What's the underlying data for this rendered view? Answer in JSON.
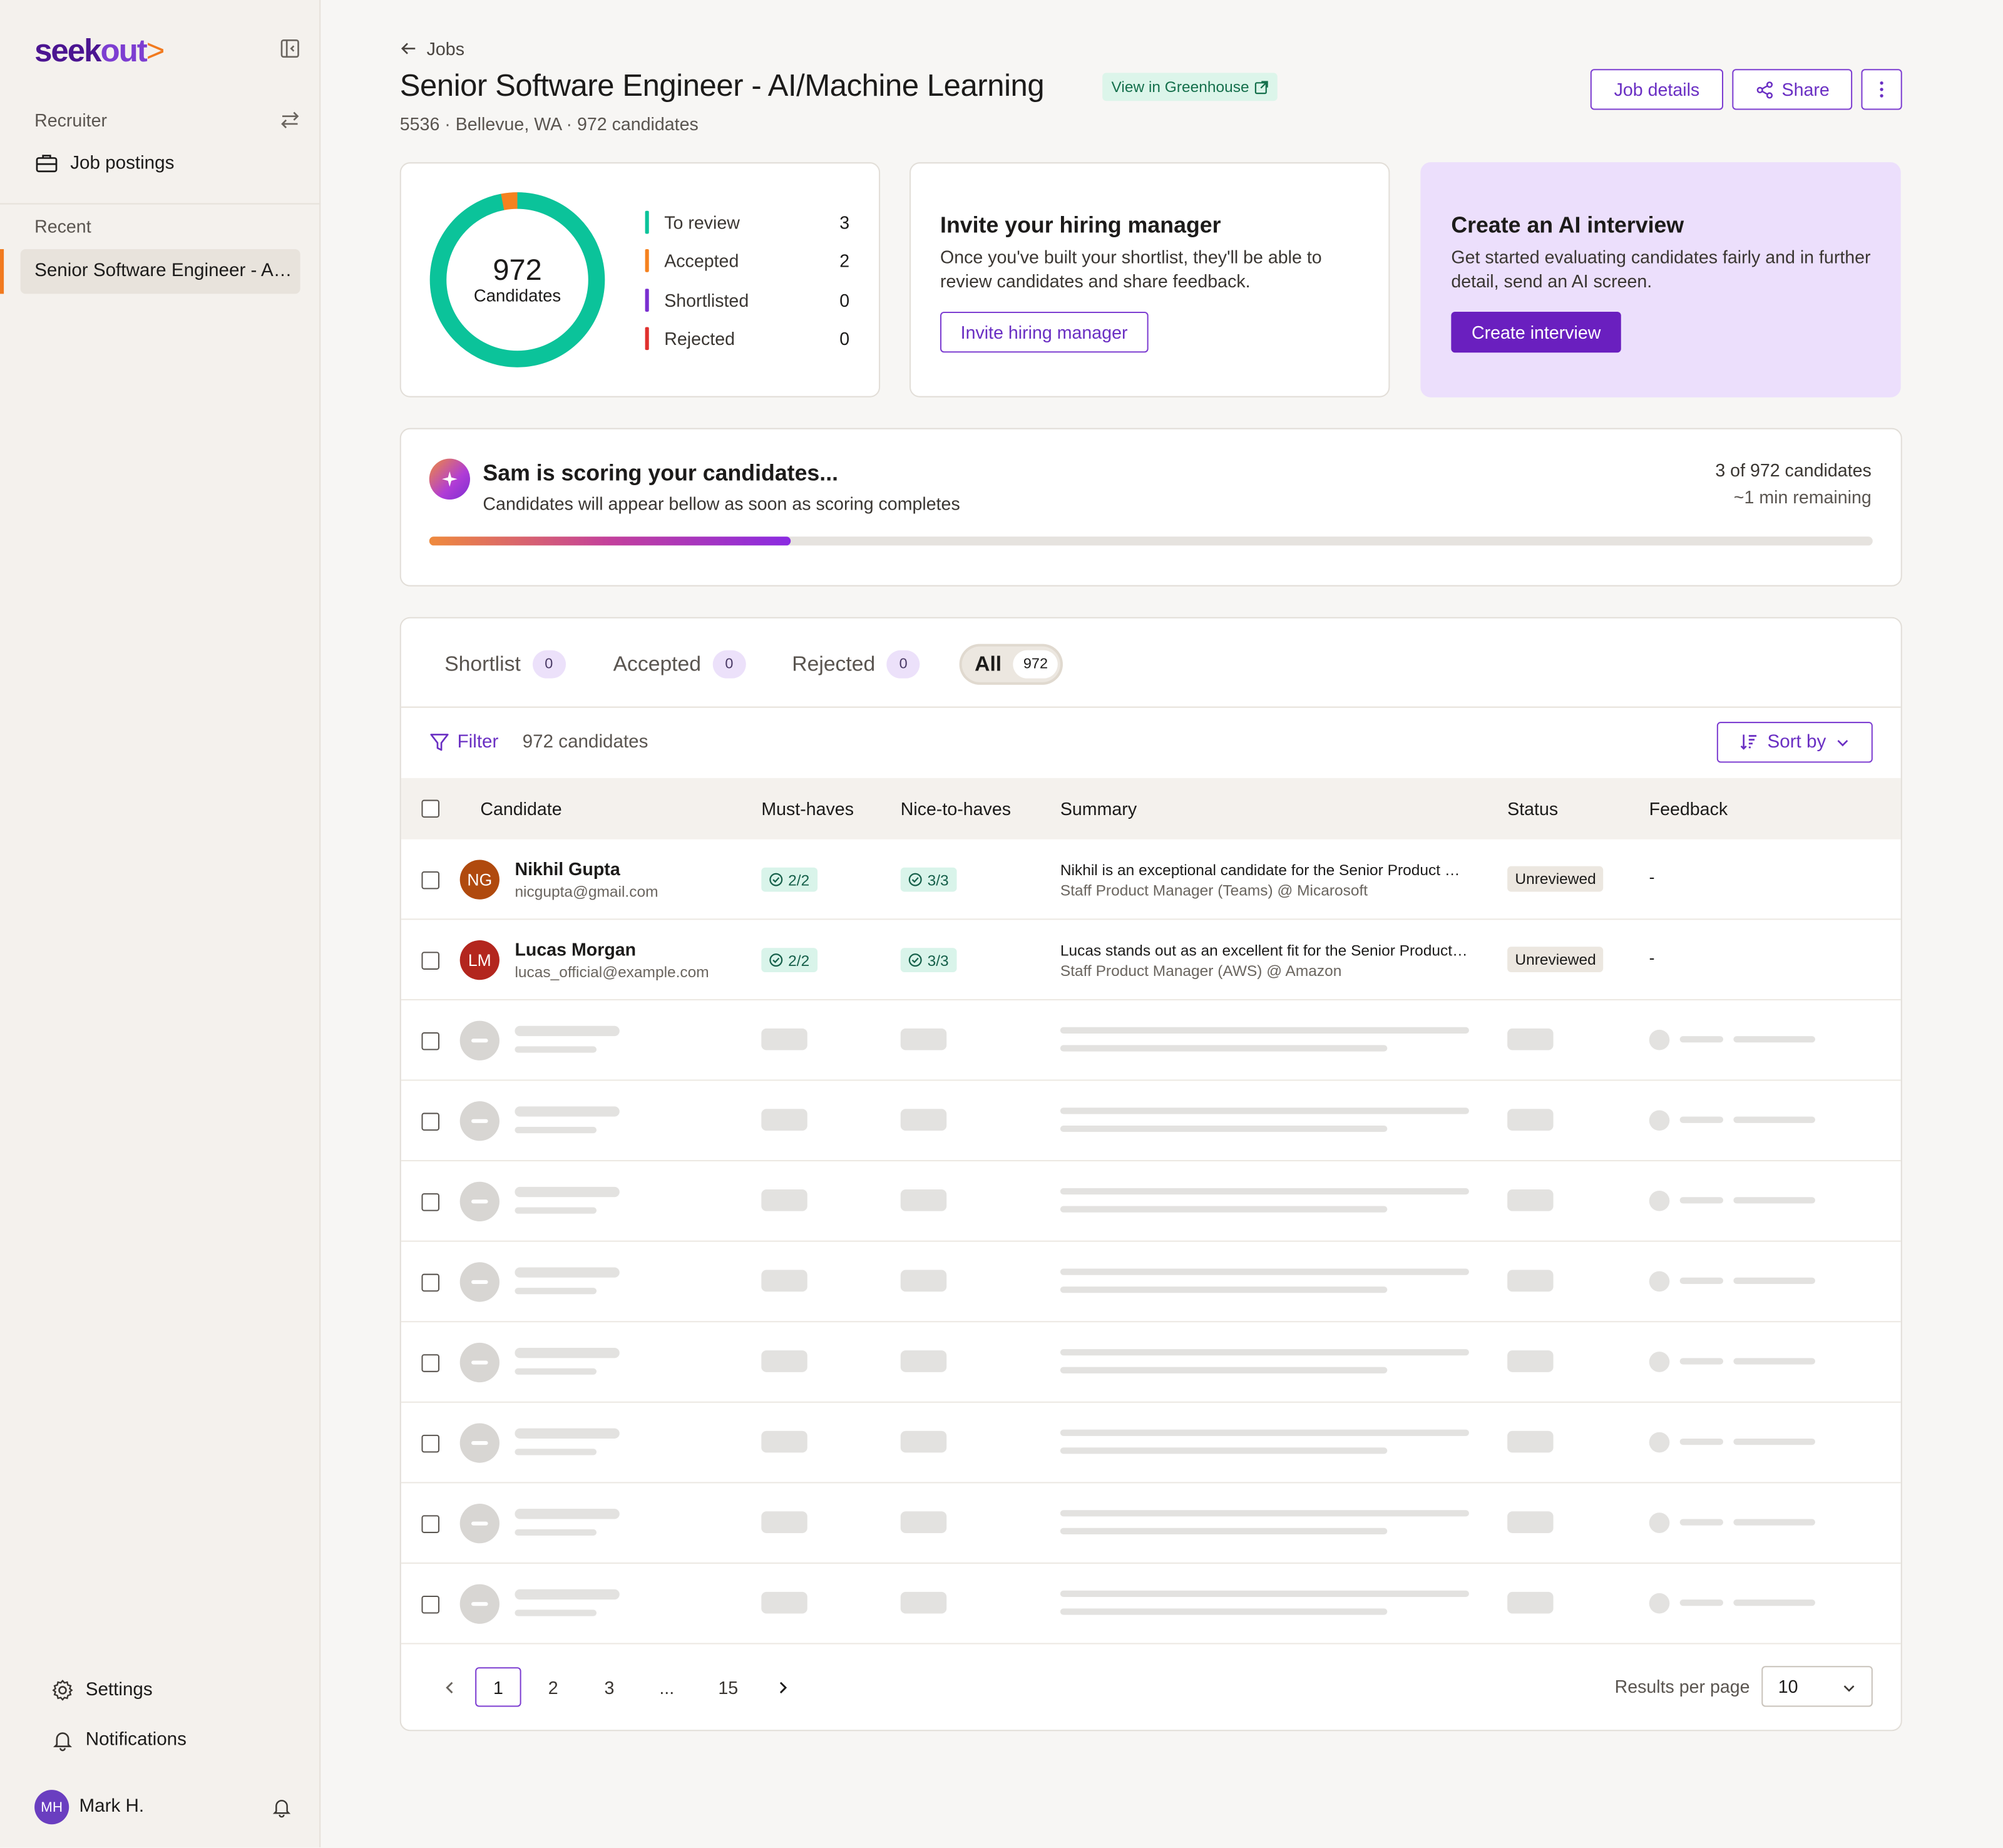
{
  "brand": {
    "logo_seek": "seek",
    "logo_out": "out",
    "logo_chevron": ">"
  },
  "sidebar": {
    "section_recruiter": "Recruiter",
    "job_postings": "Job postings",
    "section_recent": "Recent",
    "recent_item": "Senior Software Engineer - AI/Machine Learning",
    "settings": "Settings",
    "notifications": "Notifications",
    "user_initials": "MH",
    "user_name": "Mark H."
  },
  "header": {
    "back_label": "Jobs",
    "title": "Senior Software Engineer - AI/Machine Learning",
    "greenhouse_label": "View in Greenhouse",
    "subtitle": "5536 · Bellevue, WA · 972 candidates",
    "job_details": "Job details",
    "share": "Share"
  },
  "summary_card": {
    "total": "972",
    "total_label": "Candidates",
    "legend": [
      {
        "label": "To review",
        "count": "3",
        "color": "#0bc39a"
      },
      {
        "label": "Accepted",
        "count": "2",
        "color": "#f5821f"
      },
      {
        "label": "Shortlisted",
        "count": "0",
        "color": "#7a2fd0"
      },
      {
        "label": "Rejected",
        "count": "0",
        "color": "#e0302e"
      }
    ]
  },
  "invite_card": {
    "title": "Invite your hiring manager",
    "body": "Once you've built your shortlist, they'll be able to review candidates and share feedback.",
    "button": "Invite hiring manager"
  },
  "ai_card": {
    "title": "Create an AI interview",
    "body": "Get started evaluating candidates fairly and in further detail, send an AI screen.",
    "button": "Create interview"
  },
  "scoring": {
    "title": "Sam is scoring your candidates...",
    "subtitle": "Candidates will appear bellow as soon as scoring completes",
    "count": "3 of 972 candidates",
    "remaining": "~1 min remaining",
    "progress": 0.25
  },
  "tabs": [
    {
      "label": "Shortlist",
      "count": "0"
    },
    {
      "label": "Accepted",
      "count": "0"
    },
    {
      "label": "Rejected",
      "count": "0"
    },
    {
      "label": "All",
      "count": "972"
    }
  ],
  "toolbar": {
    "filter": "Filter",
    "count": "972 candidates",
    "sort": "Sort by"
  },
  "table": {
    "headers": [
      "Candidate",
      "Must-haves",
      "Nice-to-haves",
      "Summary",
      "Status",
      "Feedback"
    ],
    "rows": [
      {
        "initials": "NG",
        "avatar_color": "#b04a0e",
        "name": "Nikhil Gupta",
        "email": "nicgupta@gmail.com",
        "must": "2/2",
        "nice": "3/3",
        "summary": "Nikhil is an exceptional candidate for the Senior Product Manager role",
        "role": "Staff Product Manager (Teams) @ Micarosoft",
        "status": "Unreviewed",
        "feedback": "-"
      },
      {
        "initials": "LM",
        "avatar_color": "#b3261e",
        "name": "Lucas Morgan",
        "email": "lucas_official@example.com",
        "must": "2/2",
        "nice": "3/3",
        "summary": "Lucas stands out as an excellent fit for the Senior Product Manager role",
        "role": "Staff Product Manager (AWS) @ Amazon",
        "status": "Unreviewed",
        "feedback": "-"
      }
    ],
    "skeleton_rows": 8
  },
  "pagination": {
    "pages": [
      "1",
      "2",
      "3",
      "...",
      "15"
    ],
    "current": "1",
    "results_label": "Results per page",
    "per_page": "10"
  }
}
